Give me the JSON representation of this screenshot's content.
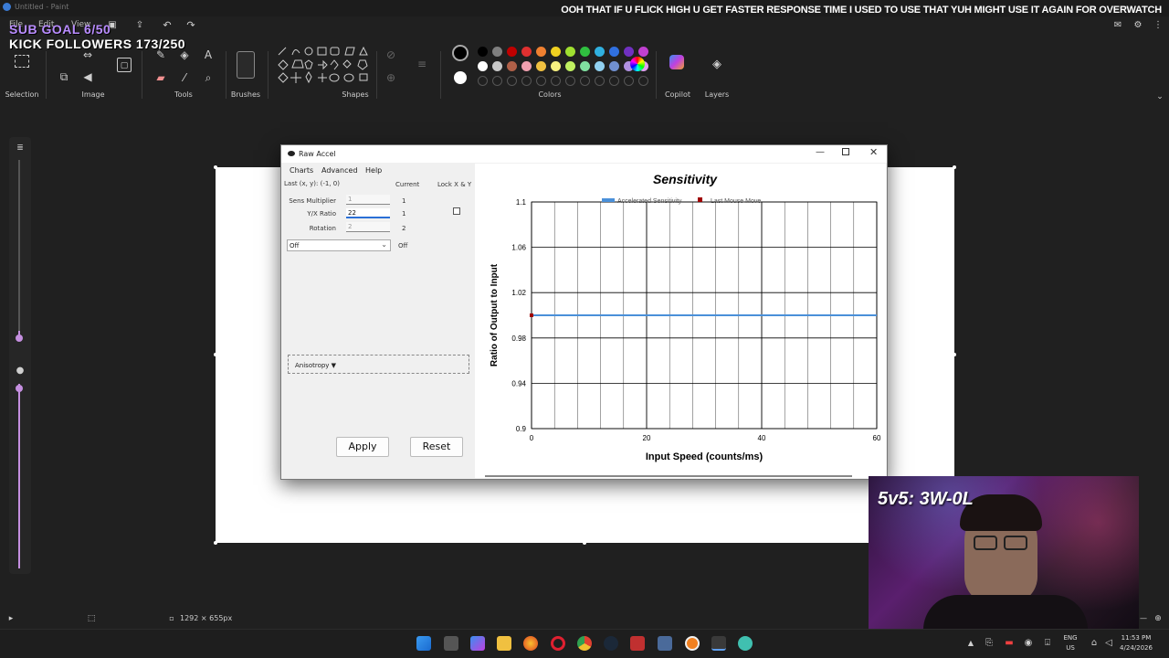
{
  "app": {
    "title": "Untitled - Paint",
    "menu": [
      "File",
      "Edit",
      "View"
    ]
  },
  "overlay": {
    "ticker": "OOH THAT IF U FLICK HIGH U GET FASTER RESPONSE TIME  I USED TO USE THAT  YUH  MIGHT USE IT AGAIN FOR OVERWATCH",
    "sub_goal": "SUB GOAL 6/50",
    "kick_followers": "KICK FOLLOWERS 173/250",
    "webcam_text": "5v5: 3W-0L"
  },
  "ribbon": {
    "groups": [
      "Selection",
      "Image",
      "Tools",
      "Brushes",
      "Shapes",
      "Colors",
      "Copilot",
      "Layers"
    ],
    "colors_row1": [
      "#000000",
      "#7f7f7f",
      "#c00000",
      "#e03030",
      "#f08030",
      "#f0d020",
      "#a0e030",
      "#30c040",
      "#30b0e0",
      "#3070e0",
      "#7030c0",
      "#c040d0"
    ],
    "colors_row2": [
      "#ffffff",
      "#c8c8c8",
      "#b06048",
      "#f0a0b0",
      "#f0c040",
      "#f8f080",
      "#c0f060",
      "#80e0a0",
      "#90d0f0",
      "#7090d0",
      "#b090e0",
      "#e0a0f0"
    ]
  },
  "dialog": {
    "title": "Raw Accel",
    "menu": [
      "Charts",
      "Advanced",
      "Help"
    ],
    "last_xy": "Last (x, y): (-1, 0)",
    "current_header": "Current",
    "lock_header": "Lock X & Y",
    "fields": [
      {
        "label": "Sens Multiplier",
        "value": "1",
        "current": "1"
      },
      {
        "label": "Y/X Ratio",
        "value": "22",
        "current": "1"
      },
      {
        "label": "Rotation",
        "value": "2",
        "current": "2"
      }
    ],
    "mode_select": "Off",
    "mode_current": "Off",
    "anisotropy": "Anisotropy ▼",
    "apply": "Apply",
    "reset": "Reset"
  },
  "chart_data": {
    "type": "line",
    "title": "Sensitivity",
    "xlabel": "Input Speed (counts/ms)",
    "ylabel": "Ratio of Output to Input",
    "xlim": [
      0,
      60
    ],
    "ylim": [
      0.9,
      1.1
    ],
    "x_ticks": [
      "0",
      "20",
      "40",
      "60"
    ],
    "y_ticks": [
      "1.1",
      "1.06",
      "1.02",
      "0.98",
      "0.94",
      "0.9"
    ],
    "legend": [
      "Accelerated Sensitivity",
      "Last Mouse Move"
    ],
    "legend_position": "top",
    "grid": true,
    "series": [
      {
        "name": "Accelerated Sensitivity",
        "x": [
          0,
          60
        ],
        "y": [
          1.0,
          1.0
        ],
        "color": "#4a90d9"
      },
      {
        "name": "Last Mouse Move",
        "x": [
          0
        ],
        "y": [
          1.0
        ],
        "color": "#a00000"
      }
    ]
  },
  "status": {
    "canvas_size": "1292 × 655px"
  },
  "tray": {
    "lang": "ENG",
    "region": "US",
    "time": "11:53 PM",
    "date": "4/24/2026"
  }
}
